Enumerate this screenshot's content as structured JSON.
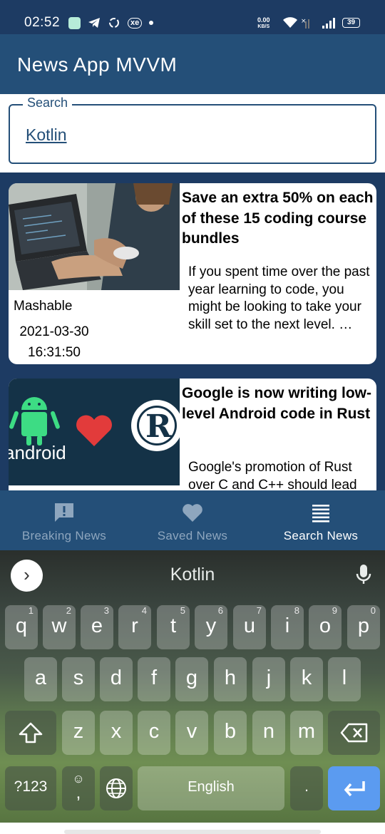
{
  "status_bar": {
    "time": "02:52",
    "xe_label": "xe",
    "speed_value": "0.00",
    "speed_unit": "KB/S",
    "battery": "39"
  },
  "app_bar": {
    "title": "News App MVVM"
  },
  "search": {
    "label": "Search",
    "value": "Kotlin"
  },
  "articles": [
    {
      "title": "Save an extra 50% on each of these 15 coding course bundles",
      "description": "If you spent time over the past year learning to code, you might be looking to take your skill set to the next level. …",
      "source": "Mashable",
      "date": "2021-03-30",
      "time": "16:31:50",
      "image": "laptop-coding-photo"
    },
    {
      "title": "Google is now writing low-level Android code in Rust",
      "description": "Google's promotion of Rust over C and C++ should lead",
      "image": "android-heart-rust-graphic",
      "image_text": "android",
      "rust_letter": "R"
    }
  ],
  "bottom_nav": {
    "items": [
      {
        "label": "Breaking News",
        "icon": "feedback-exclamation-icon",
        "active": false
      },
      {
        "label": "Saved News",
        "icon": "heart-icon",
        "active": false
      },
      {
        "label": "Search News",
        "icon": "list-lines-icon",
        "active": true
      }
    ],
    "active_color": "#ffffff",
    "inactive_color": "#8ea6be"
  },
  "keyboard": {
    "suggestion": "Kotlin",
    "row1": [
      {
        "key": "q",
        "hint": "1"
      },
      {
        "key": "w",
        "hint": "2"
      },
      {
        "key": "e",
        "hint": "3"
      },
      {
        "key": "r",
        "hint": "4"
      },
      {
        "key": "t",
        "hint": "5"
      },
      {
        "key": "y",
        "hint": "6"
      },
      {
        "key": "u",
        "hint": "7"
      },
      {
        "key": "i",
        "hint": "8"
      },
      {
        "key": "o",
        "hint": "9"
      },
      {
        "key": "p",
        "hint": "0"
      }
    ],
    "row2": [
      "a",
      "s",
      "d",
      "f",
      "g",
      "h",
      "j",
      "k",
      "l"
    ],
    "row3": [
      "z",
      "x",
      "c",
      "v",
      "b",
      "n",
      "m"
    ],
    "symbols_label": "?123",
    "comma": ",",
    "space_label": "English",
    "period": ".",
    "enter_color": "#5b9bf0"
  },
  "colors": {
    "primary": "#244f78",
    "primary_dark": "#1d3b63",
    "card_bg": "#ffffff"
  }
}
